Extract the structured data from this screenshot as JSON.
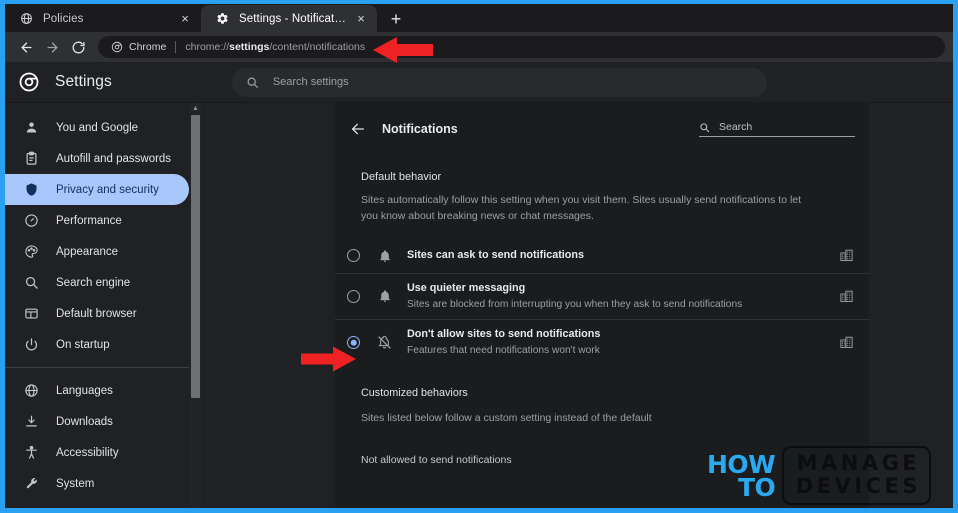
{
  "browser": {
    "tabs": [
      {
        "title": "Policies",
        "favicon": "globe-icon",
        "active": false,
        "close": "×"
      },
      {
        "title": "Settings - Notifications",
        "favicon": "gear-icon",
        "active": true,
        "close": "×"
      }
    ],
    "new_tab_label": "+",
    "toolbar": {
      "back": "back-arrow-icon",
      "forward": "forward-arrow-icon",
      "reload": "reload-icon",
      "omnibox_chrome_label": "Chrome",
      "omnibox_url_prefix": "chrome://",
      "omnibox_url_bold": "settings",
      "omnibox_url_suffix": "/content/notifications"
    }
  },
  "settings_header": {
    "logo": "chrome-logo-icon",
    "title": "Settings",
    "search_placeholder": "Search settings",
    "search_icon": "search-icon"
  },
  "sidebar": {
    "items": [
      {
        "label": "You and Google",
        "icon": "person-icon",
        "selected": false
      },
      {
        "label": "Autofill and passwords",
        "icon": "clipboard-icon",
        "selected": false
      },
      {
        "label": "Privacy and security",
        "icon": "shield-icon",
        "selected": true
      },
      {
        "label": "Performance",
        "icon": "speedometer-icon",
        "selected": false
      },
      {
        "label": "Appearance",
        "icon": "palette-icon",
        "selected": false
      },
      {
        "label": "Search engine",
        "icon": "search-icon",
        "selected": false
      },
      {
        "label": "Default browser",
        "icon": "browser-window-icon",
        "selected": false
      },
      {
        "label": "On startup",
        "icon": "power-icon",
        "selected": false
      }
    ],
    "items_secondary": [
      {
        "label": "Languages",
        "icon": "globe-icon",
        "selected": false
      },
      {
        "label": "Downloads",
        "icon": "download-icon",
        "selected": false
      },
      {
        "label": "Accessibility",
        "icon": "accessibility-icon",
        "selected": false
      },
      {
        "label": "System",
        "icon": "wrench-icon",
        "selected": false
      }
    ],
    "scroll_up": "▲",
    "scroll_down": "▼"
  },
  "page": {
    "back_icon": "back-arrow-icon",
    "title": "Notifications",
    "search_placeholder": "Search",
    "search_icon": "search-icon",
    "default_behavior_label": "Default behavior",
    "default_behavior_desc": "Sites automatically follow this setting when you visit them. Sites usually send notifications to let you know about breaking news or chat messages.",
    "options": [
      {
        "title": "Sites can ask to send notifications",
        "subtitle": "",
        "icon": "bell-icon",
        "trailing_icon": "building-icon",
        "selected": false
      },
      {
        "title": "Use quieter messaging",
        "subtitle": "Sites are blocked from interrupting you when they ask to send notifications",
        "icon": "bell-icon",
        "trailing_icon": "building-icon",
        "selected": false
      },
      {
        "title": "Don't allow sites to send notifications",
        "subtitle": "Features that need notifications won't work",
        "icon": "bell-off-icon",
        "trailing_icon": "building-icon",
        "selected": true
      }
    ],
    "customized_behaviors_label": "Customized behaviors",
    "customized_behaviors_desc": "Sites listed below follow a custom setting instead of the default",
    "not_allowed_label": "Not allowed to send notifications"
  },
  "annotations": {
    "arrows": [
      {
        "name": "url-arrow",
        "points": "left",
        "color": "#ee2222"
      },
      {
        "name": "radio-arrow",
        "points": "right",
        "color": "#ee2222"
      }
    ]
  },
  "watermark": {
    "how": "HOW",
    "to": "TO",
    "manage": "MANAGE",
    "devices": "DEVICES",
    "accent_color": "#2aa9f0"
  },
  "colors": {
    "frame": "#29a0f2",
    "chrome_bg": "#202124",
    "card_bg": "#1b1c1e",
    "accent_selected": "#a8c7fa",
    "accent_radio": "#8ab4f8",
    "annotation_red": "#ee2222"
  }
}
